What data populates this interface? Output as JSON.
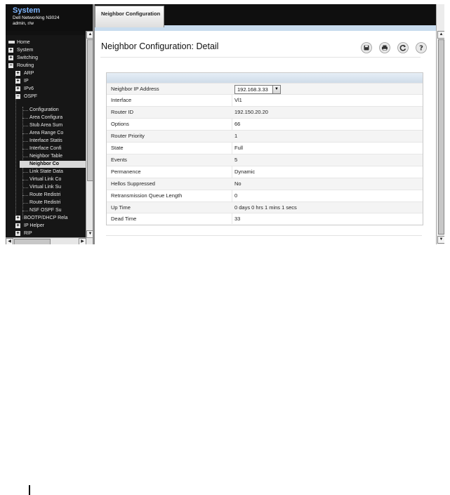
{
  "sidebar": {
    "title": "System",
    "device": "Dell Networking N3024",
    "user": "admin, r/w",
    "items": [
      {
        "label": "Home"
      },
      {
        "label": "System"
      },
      {
        "label": "Switching"
      },
      {
        "label": "Routing"
      },
      {
        "label": "ARP"
      },
      {
        "label": "IP"
      },
      {
        "label": "IPv6"
      },
      {
        "label": "OSPF"
      },
      {
        "label": "Configuration"
      },
      {
        "label": "Area Configura"
      },
      {
        "label": "Stub Area Sum"
      },
      {
        "label": "Area Range Co"
      },
      {
        "label": "Interface Statis"
      },
      {
        "label": "Interface Confi"
      },
      {
        "label": "Neighbor Table"
      },
      {
        "label": "Neighbor Co"
      },
      {
        "label": "Link State Data"
      },
      {
        "label": "Virtual Link Co"
      },
      {
        "label": "Virtual Link Su"
      },
      {
        "label": "Route Redistri"
      },
      {
        "label": "Route Redistri"
      },
      {
        "label": "NSF OSPF Su"
      },
      {
        "label": "BOOTP/DHCP Rela"
      },
      {
        "label": "IP Helper"
      },
      {
        "label": "RIP"
      }
    ]
  },
  "tab": {
    "label": "Neighbor Configuration"
  },
  "page": {
    "title": "Neighbor Configuration: Detail"
  },
  "toolbar": {
    "save_icon": "save-icon",
    "print_icon": "print-icon",
    "refresh_icon": "refresh-icon",
    "help_icon": "help-icon"
  },
  "detail": {
    "neighbor_ip_label": "Neighbor IP Address",
    "neighbor_ip_value": "192.168.3.33",
    "rows": [
      {
        "label": "Interface",
        "value": "Vl1"
      },
      {
        "label": "Router ID",
        "value": "192.150.20.20"
      },
      {
        "label": "Options",
        "value": "66"
      },
      {
        "label": "Router Priority",
        "value": "1"
      },
      {
        "label": "State",
        "value": "Full"
      },
      {
        "label": "Events",
        "value": "5"
      },
      {
        "label": "Permanence",
        "value": "Dynamic"
      },
      {
        "label": "Hellos Suppressed",
        "value": "No"
      },
      {
        "label": "Retransmission Queue Length",
        "value": "0"
      },
      {
        "label": "Up Time",
        "value": "0 days 0 hrs 1 mins 1 secs"
      },
      {
        "label": "Dead Time",
        "value": "33"
      }
    ]
  }
}
